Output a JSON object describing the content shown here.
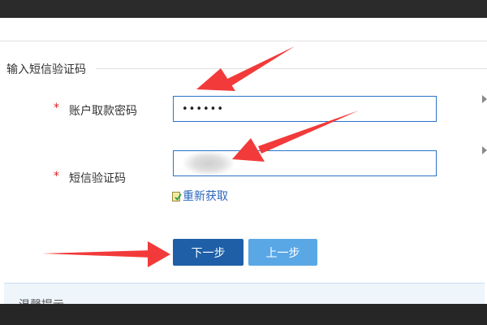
{
  "section": {
    "title": "输入短信验证码"
  },
  "form": {
    "required_mark": "*",
    "password_label": "账户取款密码",
    "password_value": "••••••",
    "sms_label": "短信验证码",
    "sms_value": "",
    "refresh_label": "重新获取"
  },
  "buttons": {
    "next_label": "下一步",
    "prev_label": "上一步"
  },
  "tips": {
    "title": "温馨提示"
  },
  "colors": {
    "primary_button": "#1e5fa8",
    "secondary_button": "#5aa7e6",
    "input_border": "#2a74c9",
    "required_star": "#e02020",
    "link": "#2a66c0",
    "annotation_arrow": "#f23a3a"
  },
  "icons": {
    "refresh": "refresh-icon",
    "side_markers": "triangle-right-icon"
  }
}
